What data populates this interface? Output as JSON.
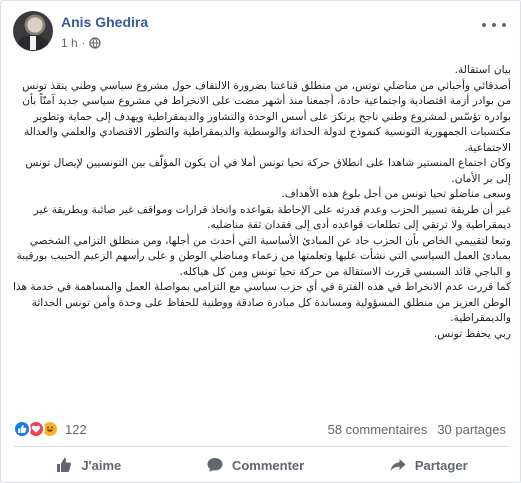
{
  "post": {
    "author": "Anis Ghedira",
    "time": "1 h",
    "separator": "·",
    "privacy_icon": "globe-icon",
    "menu_icon": "more-icon",
    "paragraphs": [
      "بيان استقالة.",
      "أصدقائي وأحبائي من مناضلي تونس، من منطلق قناعتنا بضرورة الالتفاف حول مشروع سياسي وطني ينقذ تونس من بوادر أزمة اقتصادية واجتماعية حادة، أجمعنا منذ أشهر مضت على الانخراط في مشروع سياسي جديد آمنّاً بأن بوادره تؤسّس لمشروع وطني ناجح يرتكز على أسس الوحدة والتشاور والديمقراطية ويهدف إلى حماية وتطوير مكتسبات الجمهورية التونسية كنموذج لدولة الحداثة والوسطية والديمقراطية والتطور الاقتصادي والعلمي والعدالة الاجتماعية.",
      "وكان اجتماع المنستير شاهدا على انطلاق حركة تحيا تونس أملا في أن يكون المؤلّف بين التونسيين لإيصال تونس إلى بر الأمان.",
      "وسعى مناضلو تحيا تونس من أجل بلوغ هذه الأهداف.",
      "غير أن طريقة تسيير الحزب وعدم قدرته على الإحاطة بقواعده واتخاذ قرارات ومواقف غير صائبة وبطريقة غير ديمقراطية ولا ترتقي إلى تطلعات قواعده أدى إلى فقدان ثقة مناضليه.",
      "وتبعا لتقييمي الخاص بأن الحزب حاد عن المبادئ الأساسية التي أحدث من أجلها، ومن منطلق التزامي الشخصي بمبادئ العمل السياسي التي نشأت عليها وتعلمتها من زعماء ومناضلي الوطن و على رأسهم الزعيم الحبيب بورقيبة و الباجي قائد السبسي قررت الاستقالة من حركة تحيا تونس ومن كل هياكله.",
      "كما قررت عدم الانخراط في هذه الفترة في أي حزب سياسي مع التزامي بمواصلة العمل والمساهمة في خدمة هذا الوطن العزيز من منطلق المسؤولية ومساندة كل مبادرة صادقة ووطنية للحفاظ على وحدة وأمن تونس الحداثة والديمقراطية.",
      "ربي يحفظ تونس."
    ]
  },
  "reactions": {
    "icons": [
      "like-reaction-icon",
      "love-reaction-icon",
      "haha-reaction-icon"
    ],
    "colors": {
      "like": "#1877f2",
      "love": "#f33e58",
      "haha": "#f7b125"
    },
    "count": "122"
  },
  "stats": {
    "comments": "58 commentaires",
    "shares": "30 partages"
  },
  "actions": {
    "like_label": "J'aime",
    "comment_label": "Commenter",
    "share_label": "Partager"
  },
  "colors": {
    "author_link": "#385898",
    "secondary_text": "#606770",
    "divider": "#dadde1"
  }
}
